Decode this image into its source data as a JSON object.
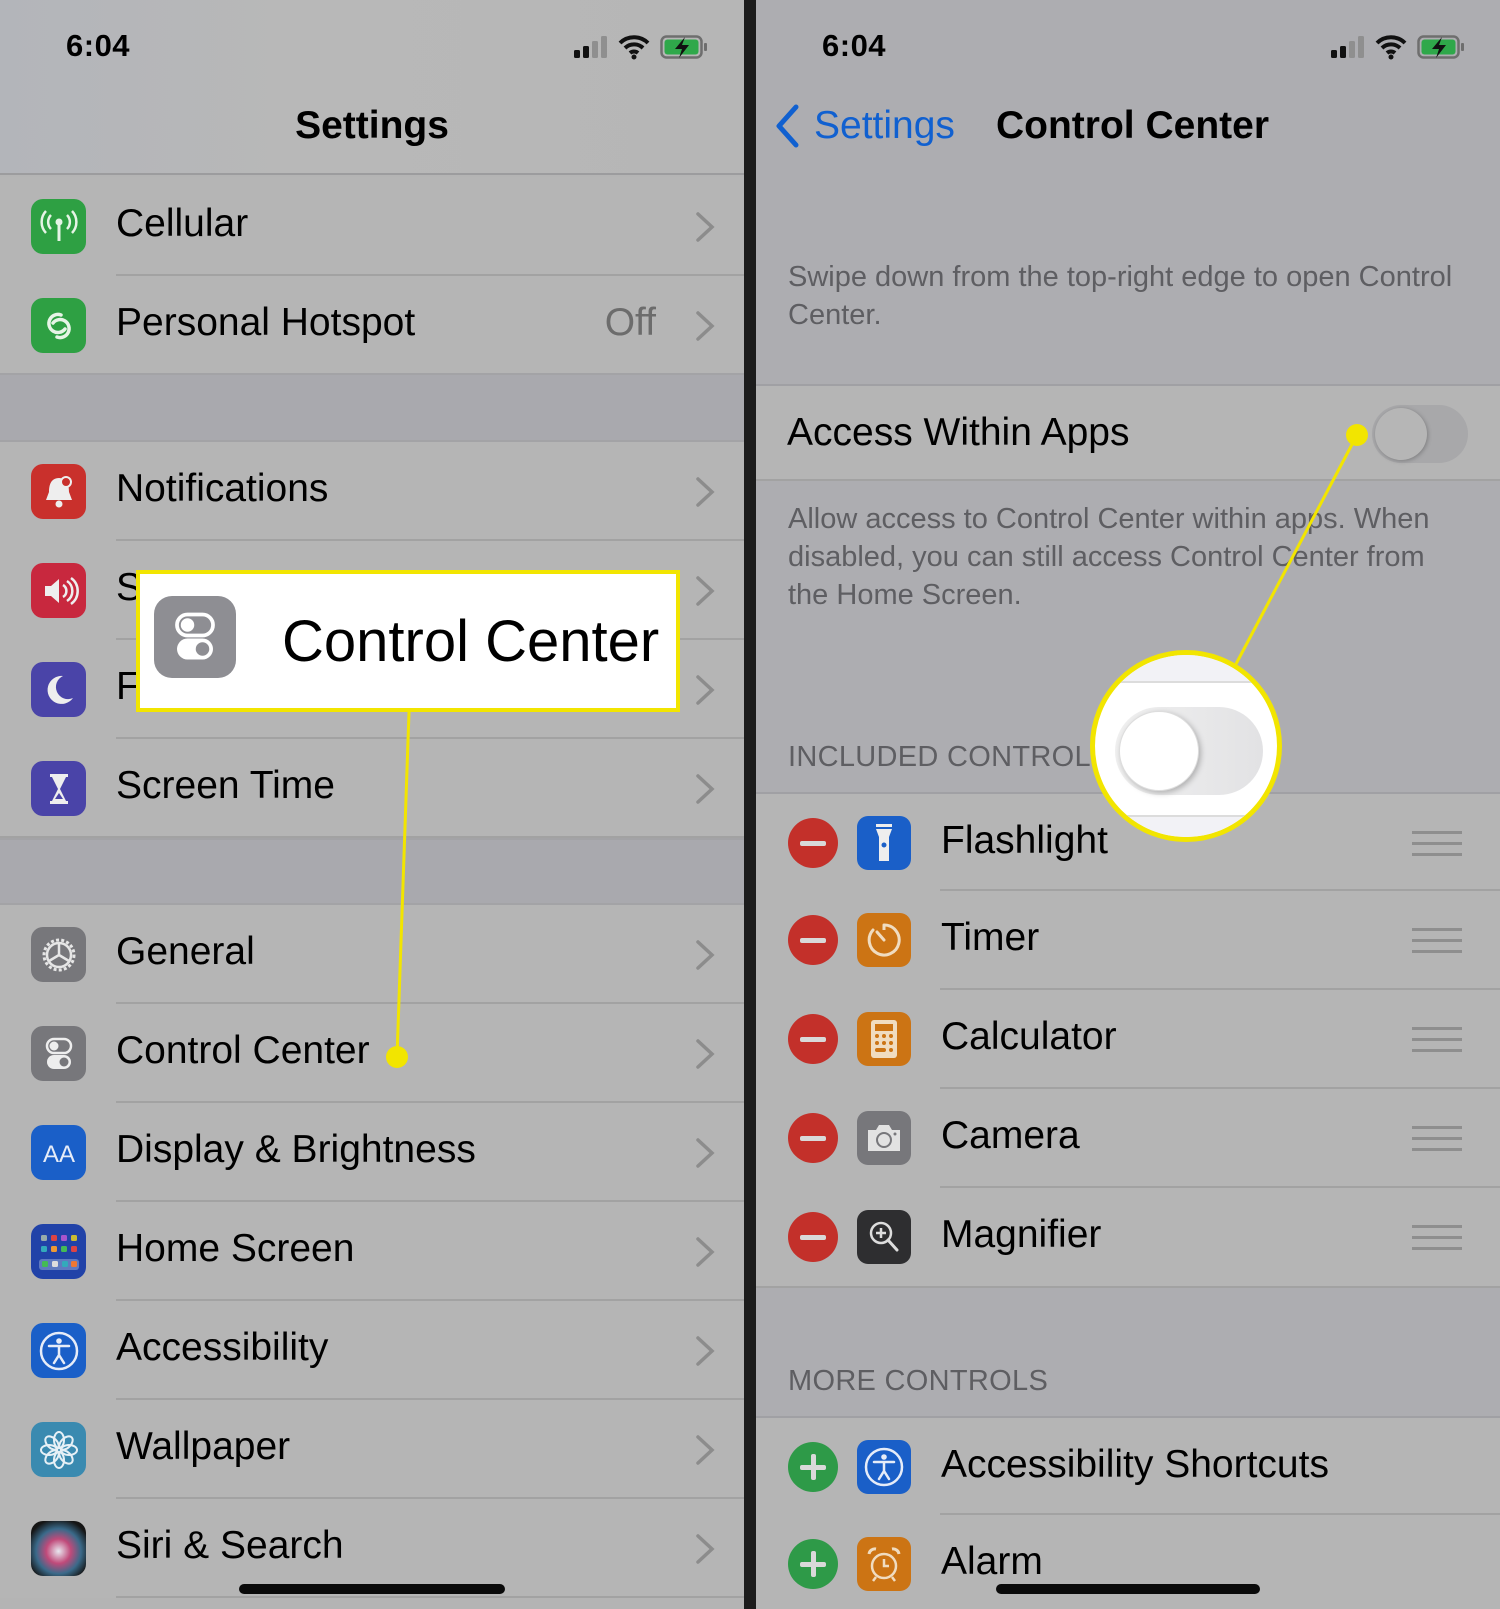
{
  "colors": {
    "annotation_yellow": "#f2e500",
    "ios_blue": "#1060d0",
    "remove_red": "#c3302a",
    "add_green": "#2e9a48"
  },
  "left_screen": {
    "status_bar": {
      "time": "6:04",
      "icons": [
        "cellular-signal-icon",
        "wifi-icon",
        "battery-charging-icon"
      ]
    },
    "title": "Settings",
    "groups": [
      {
        "items": [
          {
            "label": "Cellular",
            "icon": "cellular-antenna-icon",
            "icon_color": "#2ea043",
            "value": ""
          },
          {
            "label": "Personal Hotspot",
            "icon": "hotspot-link-icon",
            "icon_color": "#2ea043",
            "value": "Off"
          }
        ]
      },
      {
        "items": [
          {
            "label": "Notifications",
            "icon": "bell-icon",
            "icon_color": "#c9302c",
            "value": ""
          },
          {
            "label": "Sounds & Haptics",
            "icon": "speaker-icon",
            "icon_color": "#c8283e",
            "value": ""
          },
          {
            "label": "Focus",
            "icon": "moon-icon",
            "icon_color": "#4a44a8",
            "value": ""
          },
          {
            "label": "Screen Time",
            "icon": "hourglass-icon",
            "icon_color": "#4a44a8",
            "value": ""
          }
        ]
      },
      {
        "items": [
          {
            "label": "General",
            "icon": "gear-icon",
            "icon_color": "#77777b",
            "value": ""
          },
          {
            "label": "Control Center",
            "icon": "toggles-icon",
            "icon_color": "#77777b",
            "value": ""
          },
          {
            "label": "Display & Brightness",
            "icon": "text-size-icon",
            "icon_color": "#1a5fc8",
            "value": ""
          },
          {
            "label": "Home Screen",
            "icon": "app-grid-icon",
            "icon_color": "#2142a8",
            "value": ""
          },
          {
            "label": "Accessibility",
            "icon": "accessibility-icon",
            "icon_color": "#1a5fc8",
            "value": ""
          },
          {
            "label": "Wallpaper",
            "icon": "flower-icon",
            "icon_color": "#3a8ab0",
            "value": ""
          },
          {
            "label": "Siri & Search",
            "icon": "siri-icon",
            "icon_color": "#1a1a1a",
            "value": ""
          }
        ]
      }
    ],
    "callout": {
      "label": "Control Center",
      "icon": "toggles-icon"
    }
  },
  "right_screen": {
    "status_bar": {
      "time": "6:04",
      "icons": [
        "cellular-signal-icon",
        "wifi-icon",
        "battery-charging-icon"
      ]
    },
    "back_label": "Settings",
    "title": "Control Center",
    "intro_text": "Swipe down from the top-right edge to open Control Center.",
    "access_within_apps": {
      "label": "Access Within Apps",
      "enabled": false
    },
    "access_description": "Allow access to Control Center within apps. When disabled, you can still access Control Center from the Home Screen.",
    "included_header": "INCLUDED CONTROLS",
    "included_controls": [
      {
        "label": "Flashlight",
        "icon": "flashlight-icon",
        "icon_color": "#1a5fc8"
      },
      {
        "label": "Timer",
        "icon": "timer-icon",
        "icon_color": "#cc7414"
      },
      {
        "label": "Calculator",
        "icon": "calculator-icon",
        "icon_color": "#cc7414"
      },
      {
        "label": "Camera",
        "icon": "camera-icon",
        "icon_color": "#77777b"
      },
      {
        "label": "Magnifier",
        "icon": "magnifier-icon",
        "icon_color": "#2e2e30"
      }
    ],
    "more_header": "MORE CONTROLS",
    "more_controls": [
      {
        "label": "Accessibility Shortcuts",
        "icon": "accessibility-icon",
        "icon_color": "#1a5fc8"
      },
      {
        "label": "Alarm",
        "icon": "alarm-clock-icon",
        "icon_color": "#cc7414"
      }
    ]
  }
}
